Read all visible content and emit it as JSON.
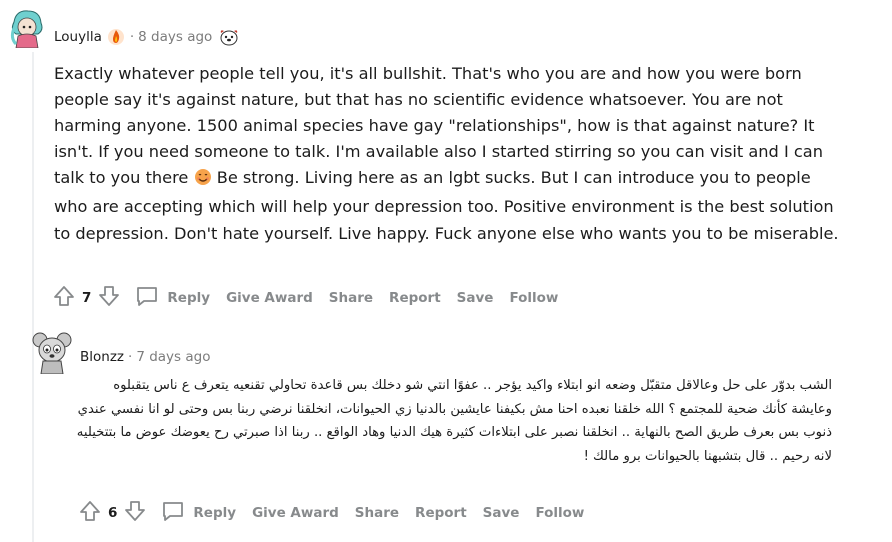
{
  "comments": [
    {
      "author": "Louylla",
      "separator": "·",
      "time": "8 days ago",
      "body": "Exactly whatever people tell you, it's all bullshit. That's who you are and how you were born people say it's against nature, but that has no scientific evidence whatsoever. You are not harming anyone. 1500 animal species have gay \"relationships\", how is that against nature? It isn't. If you need someone to talk. I'm available also I started stirring so you can visit and I can talk to you there",
      "body_after_emoji": " Be strong. Living here as an lgbt sucks. But I can introduce you to people who are accepting which will help your depression too. Positive environment is the best solution to depression. Don't hate yourself. Live happy. Fuck anyone else who wants you to be miserable.",
      "score": "7",
      "actions": {
        "reply": "Reply",
        "award": "Give Award",
        "share": "Share",
        "report": "Report",
        "save": "Save",
        "follow": "Follow"
      }
    },
    {
      "author": "Blonzz",
      "separator": "·",
      "time": "7 days ago",
      "body": "الشب بدوّر على حل وعالاقل متقبّل وضعه انو ابتلاء واكيد يؤجر .. عفوًا انتي شو دخلك بس قاعدة تحاولي تقنعيه يتعرف ع ناس يتقبلوه وعايشة كأنك ضحية للمجتمع ؟ الله خلقنا نعبده احنا مش بكيفنا عايشين بالدنيا زي الحيوانات، انخلقنا نرضي ربنا بس وحتى لو انا نفسي عندي ذنوب بس بعرف طريق الصح بالنهاية .. انخلقنا نصبر على ابتلاءات كثيرة هيك الدنيا وهاد الواقع .. ربنا اذا صبرتي رح يعوضك عوض ما بتتخيليه لانه رحيم .. قال بتشبهنا بالحيوانات برو مالك !",
      "score": "6",
      "actions": {
        "reply": "Reply",
        "award": "Give Award",
        "share": "Share",
        "report": "Report",
        "save": "Save",
        "follow": "Follow"
      }
    }
  ],
  "colors": {
    "meta": "#7c7c7c",
    "actions": "#878a8c",
    "avatar1_bg": "#7fd3d0",
    "avatar2_bg": "#d9d9d9",
    "flair_fire": "#e8590c"
  }
}
